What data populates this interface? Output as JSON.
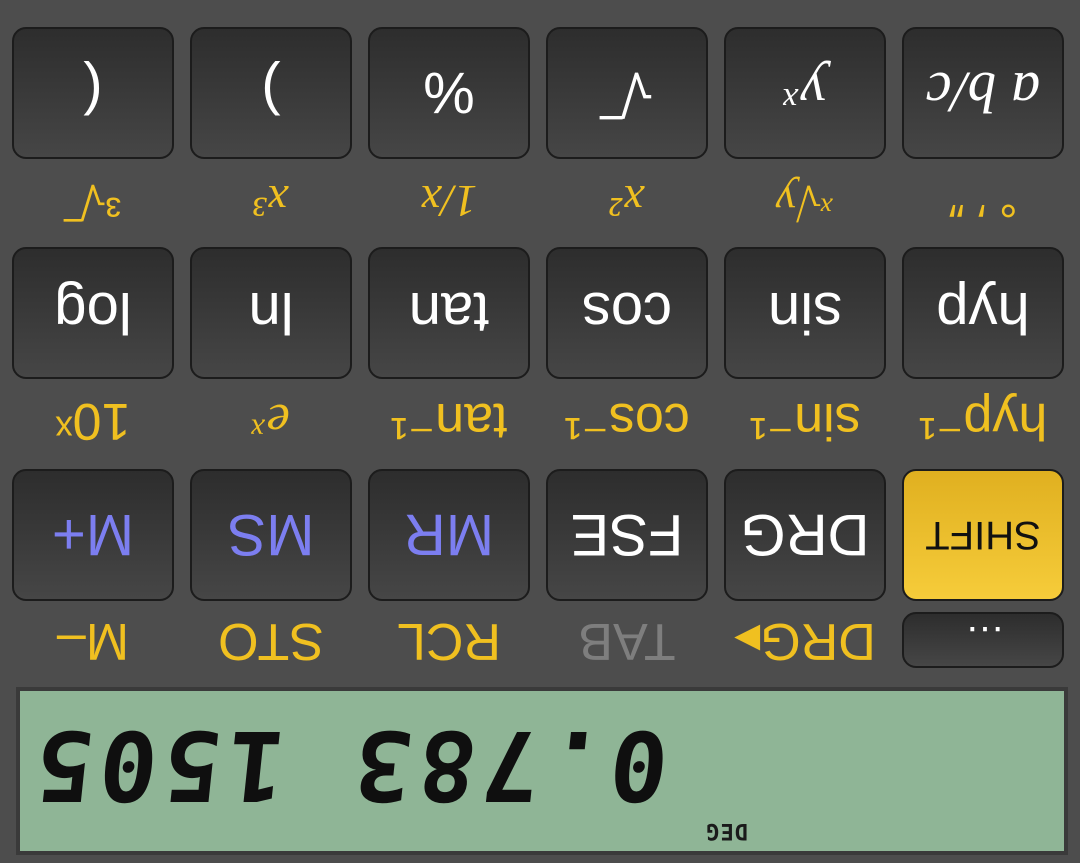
{
  "display": {
    "mode": "DEG",
    "value": "0.783 1505"
  },
  "row_memory": {
    "alt_labels": [
      "…",
      "DRG▸",
      "TAB",
      "RCL",
      "STO",
      "M–"
    ],
    "keys": [
      "SHIFT",
      "DRG",
      "FSE",
      "MR",
      "MS",
      "M+"
    ]
  },
  "row_trig": {
    "alt_labels": [
      "hyp⁻¹",
      "sin⁻¹",
      "cos⁻¹",
      "tan⁻¹",
      "eˣ",
      "10ˣ"
    ],
    "keys": [
      "hyp",
      "sin",
      "cos",
      "tan",
      "ln",
      "log"
    ]
  },
  "row_power": {
    "alt_labels": [
      "° ′ ″",
      "ˣ√y",
      "x²",
      "1/x",
      "x³",
      "³√‾"
    ],
    "keys": [
      "a b/c",
      "yˣ",
      "√‾",
      "%",
      ")",
      "("
    ]
  },
  "colors": {
    "background": "#4d4d4d",
    "lcd": "#8fb596",
    "alt_text": "#f0c020",
    "memory_key_text": "#7c7ef0",
    "shift_key": "#f0c030"
  }
}
